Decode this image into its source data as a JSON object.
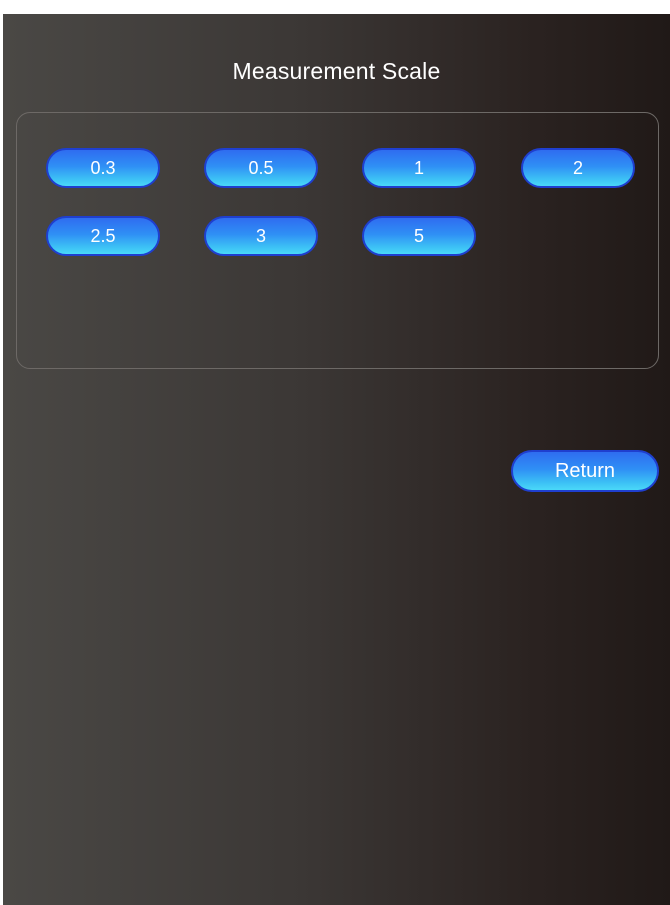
{
  "title": "Measurement Scale",
  "scales": [
    "0.3",
    "0.5",
    "1",
    "2",
    "2.5",
    "3",
    "5"
  ],
  "return_label": "Return",
  "colors": {
    "button_top": "#2f6df0",
    "button_bottom": "#4ad9f8",
    "button_border": "#1f3fcf",
    "text": "#ffffff"
  }
}
